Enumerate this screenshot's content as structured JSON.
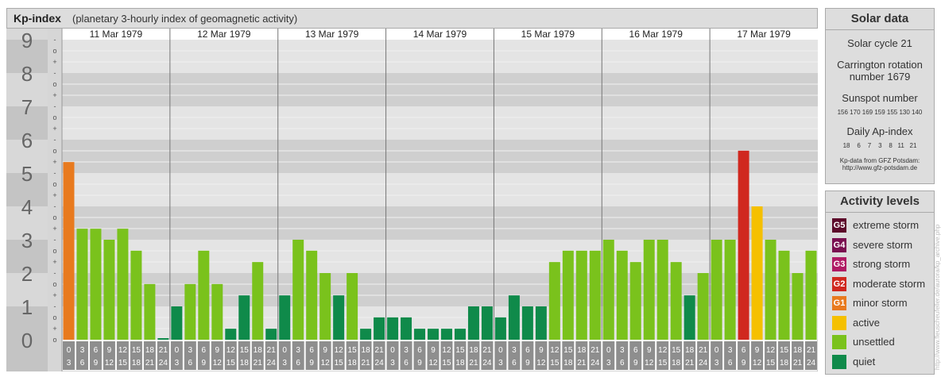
{
  "header": {
    "title": "Kp-index",
    "subtitle": "(planetary 3-hourly index of geomagnetic activity)"
  },
  "chart_data": {
    "type": "bar",
    "ylim": [
      0,
      9
    ],
    "y_tick_labels": [
      "0",
      "1",
      "2",
      "3",
      "4",
      "5",
      "6",
      "7",
      "8",
      "9"
    ],
    "minor_tick_labels": [
      "+",
      "o",
      "-"
    ],
    "days": [
      "11 Mar 1979",
      "12 Mar 1979",
      "13 Mar 1979",
      "14 Mar 1979",
      "15 Mar 1979",
      "16 Mar 1979",
      "17 Mar 1979"
    ],
    "hour_labels_top": [
      "0",
      "3",
      "6",
      "9",
      "12",
      "15",
      "18",
      "21"
    ],
    "hour_labels_bottom": [
      "3",
      "6",
      "9",
      "12",
      "15",
      "18",
      "21",
      "24"
    ],
    "values": [
      [
        5.33,
        3.33,
        3.33,
        3.0,
        3.33,
        2.67,
        1.67,
        0.0
      ],
      [
        1.0,
        1.67,
        2.67,
        1.67,
        0.33,
        1.33,
        2.33,
        0.33
      ],
      [
        1.33,
        3.0,
        2.67,
        2.0,
        1.33,
        2.0,
        0.33,
        0.67
      ],
      [
        0.67,
        0.67,
        0.33,
        0.33,
        0.33,
        0.33,
        1.0,
        1.0
      ],
      [
        0.67,
        1.33,
        1.0,
        1.0,
        2.33,
        2.67,
        2.67,
        2.67
      ],
      [
        3.0,
        2.67,
        2.33,
        3.0,
        3.0,
        2.33,
        1.33,
        2.0
      ],
      [
        3.0,
        3.0,
        5.67,
        4.0,
        3.0,
        2.67,
        2.0,
        2.67
      ]
    ],
    "levels": [
      [
        "G1",
        "U",
        "U",
        "U",
        "U",
        "U",
        "U",
        "Q"
      ],
      [
        "Q",
        "U",
        "U",
        "U",
        "Q",
        "Q",
        "U",
        "Q"
      ],
      [
        "Q",
        "U",
        "U",
        "U",
        "Q",
        "U",
        "Q",
        "Q"
      ],
      [
        "Q",
        "Q",
        "Q",
        "Q",
        "Q",
        "Q",
        "Q",
        "Q"
      ],
      [
        "Q",
        "Q",
        "Q",
        "Q",
        "U",
        "U",
        "U",
        "U"
      ],
      [
        "U",
        "U",
        "U",
        "U",
        "U",
        "U",
        "Q",
        "U"
      ],
      [
        "U",
        "U",
        "G2",
        "A",
        "U",
        "U",
        "U",
        "U"
      ]
    ],
    "colors": {
      "G5": "#5c0a2a",
      "G4": "#7a1050",
      "G3": "#b01a64",
      "G2": "#d0281f",
      "G1": "#e87a1e",
      "A": "#f5c000",
      "U": "#7ac21c",
      "Q": "#0f8a4a"
    }
  },
  "solar": {
    "title": "Solar data",
    "cycle": "Solar cycle 21",
    "carrington_line1": "Carrington rotation",
    "carrington_line2": "number 1679",
    "sunspot_title": "Sunspot number",
    "sunspot_values": "156 170 169 159 155 130 140",
    "ap_title": "Daily Ap-index",
    "ap_values": "18    6    7    3    8   11   21",
    "source_line1": "Kp-data from GFZ Potsdam:",
    "source_line2": "http://www.gfz-potsdam.de"
  },
  "legend": {
    "title": "Activity levels",
    "items": [
      {
        "code": "G5",
        "label": "extreme storm",
        "color": "#5c0a2a"
      },
      {
        "code": "G4",
        "label": "severe storm",
        "color": "#7a1050"
      },
      {
        "code": "G3",
        "label": "strong storm",
        "color": "#b01a64"
      },
      {
        "code": "G2",
        "label": "moderate storm",
        "color": "#d0281f"
      },
      {
        "code": "G1",
        "label": "minor storm",
        "color": "#e87a1e"
      },
      {
        "code": "",
        "label": "active",
        "color": "#f5c000"
      },
      {
        "code": "",
        "label": "unsettled",
        "color": "#7ac21c"
      },
      {
        "code": "",
        "label": "quiet",
        "color": "#0f8a4a"
      }
    ]
  },
  "watermark": "http://www.fleuscheufeller.de/aurora/kp_archive.php"
}
